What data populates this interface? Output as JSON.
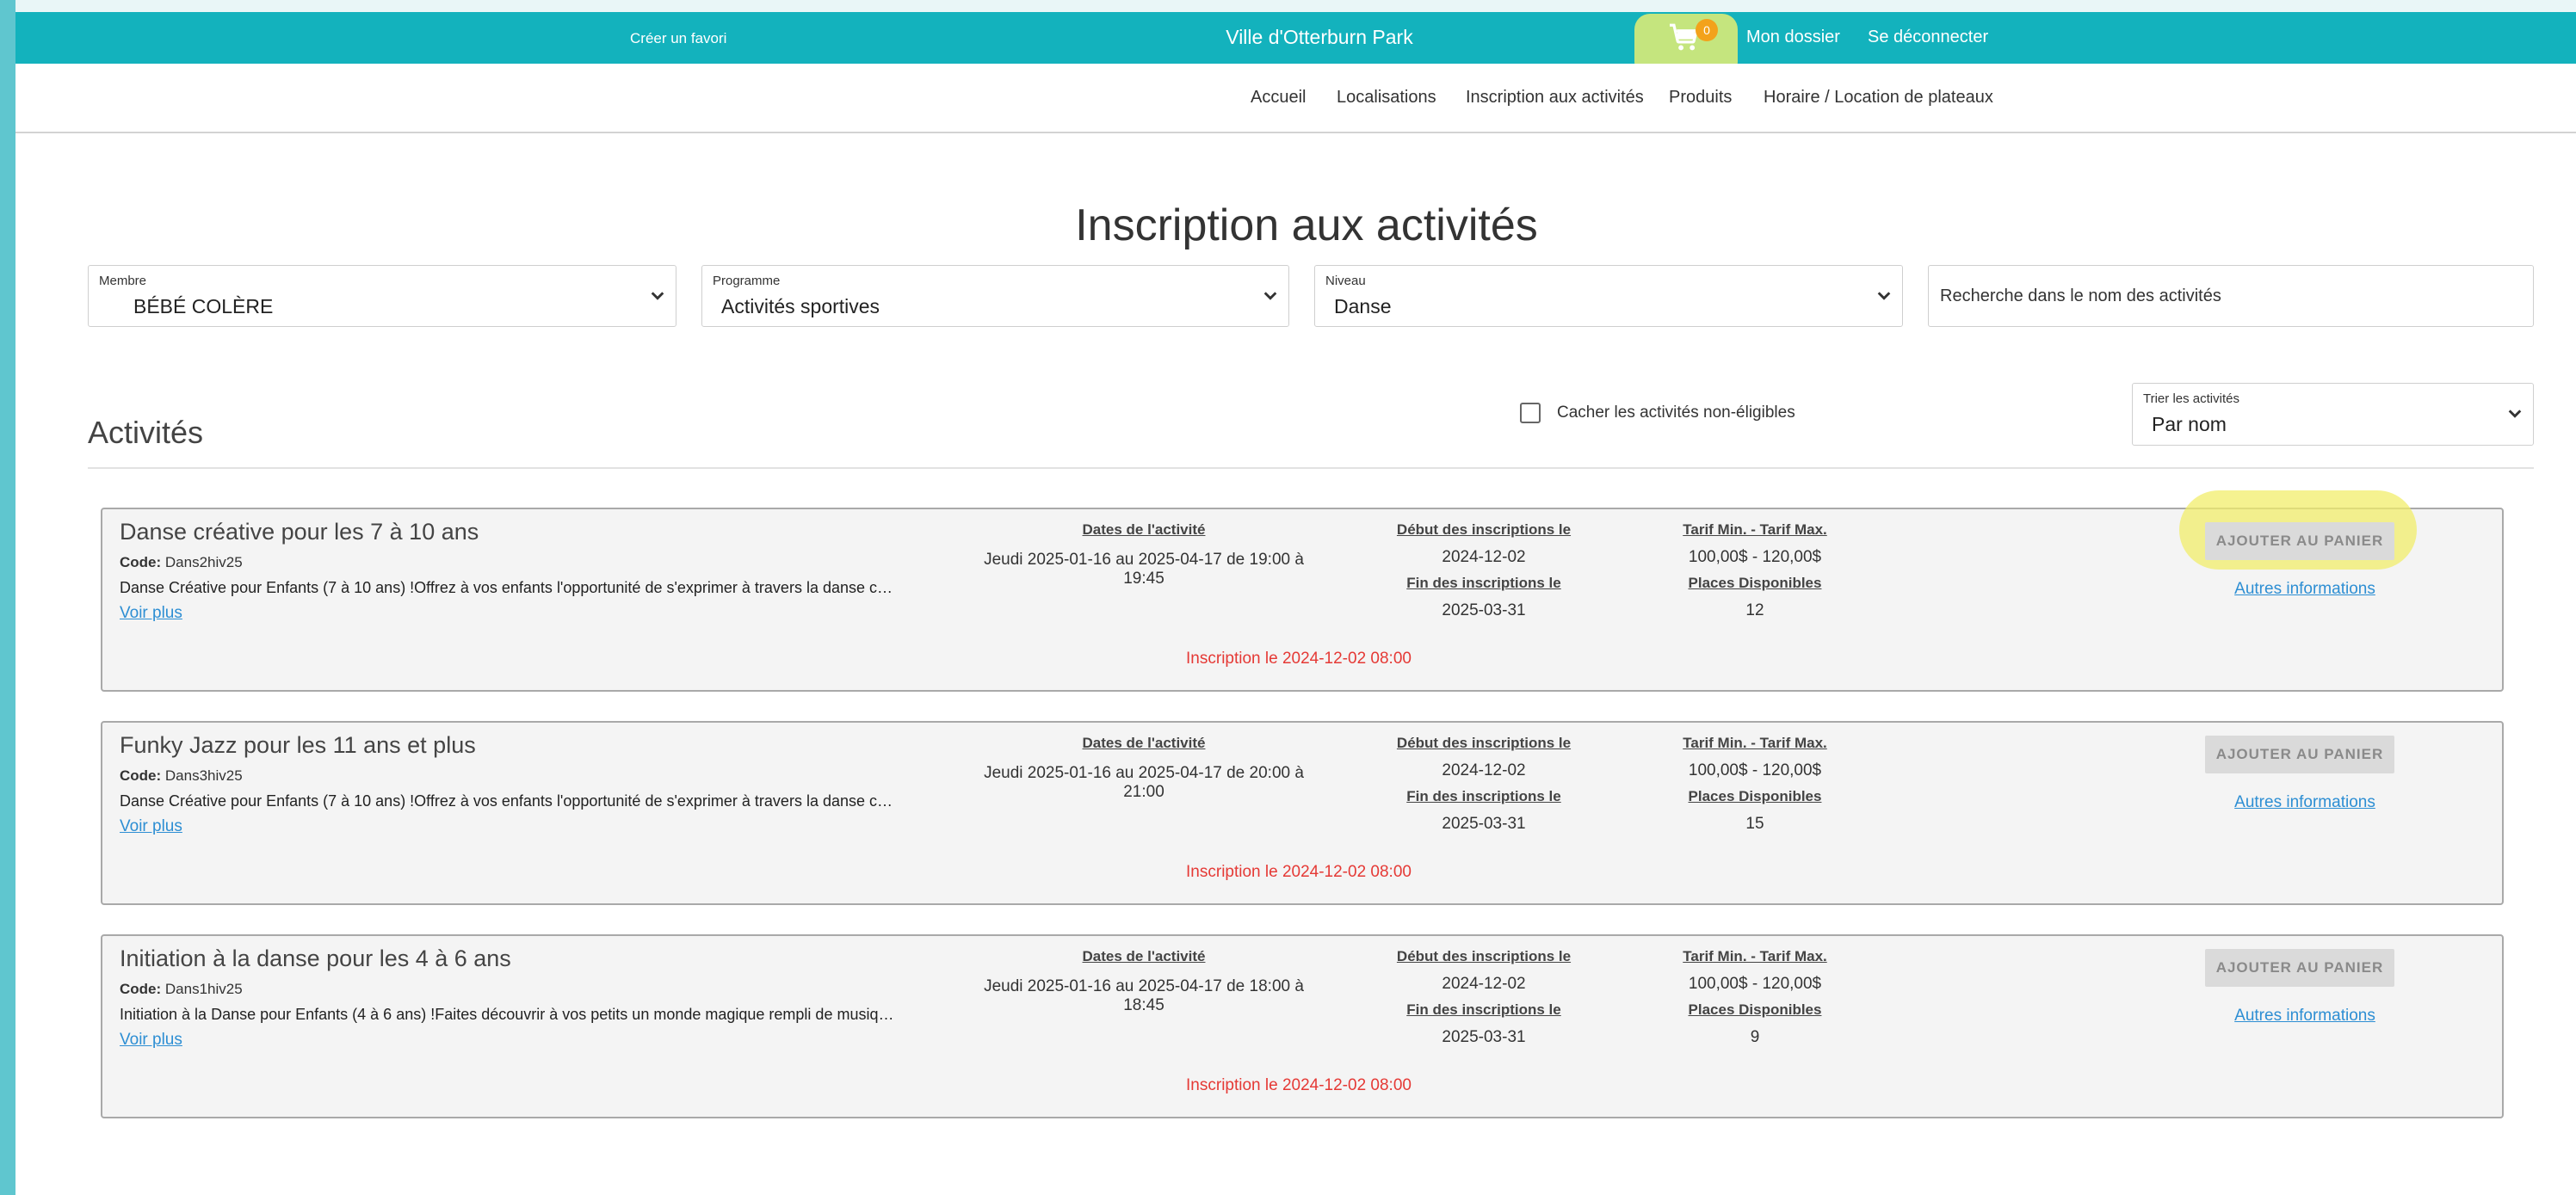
{
  "header": {
    "favorite": "Créer un favori",
    "site_name": "Ville d'Otterburn Park",
    "cart_count": "0",
    "account": "Mon dossier",
    "logout": "Se déconnecter",
    "cart_icon": "shopping-cart-icon"
  },
  "nav": {
    "items": [
      "Accueil",
      "Localisations",
      "Inscription aux activités",
      "Produits",
      "Horaire / Location de plateaux"
    ]
  },
  "page": {
    "title": "Inscription aux activités"
  },
  "filters": {
    "member_label": "Membre",
    "member_value": "BÉBÉ COLÈRE",
    "program_label": "Programme",
    "program_value": "Activités sportives",
    "level_label": "Niveau",
    "level_value": "Danse",
    "search_placeholder": "Recherche dans le nom des activités"
  },
  "activities_section": {
    "title": "Activités",
    "hide_label": "Cacher les activités non-éligibles",
    "sort_label": "Trier les activités",
    "sort_value": "Par nom"
  },
  "labels": {
    "code": "Code:",
    "dates": "Dates de l'activité",
    "reg_start": "Début des inscriptions le",
    "reg_end": "Fin des inscriptions le",
    "tariff": "Tarif Min. - Tarif Max.",
    "places": "Places Disponibles",
    "see_more": "Voir plus",
    "add_to_cart": "AJOUTER AU PANIER",
    "more_info": "Autres informations"
  },
  "activities": [
    {
      "name": "Danse créative pour les 7 à 10 ans",
      "code": "Dans2hiv25",
      "description": "Danse Créative pour Enfants (7 à 10 ans) !Offrez à vos enfants l'opportunité de s'exprimer à travers la danse créative",
      "dates": "Jeudi 2025-01-16 au 2025-04-17 de 19:00 à 19:45",
      "reg_start": "2024-12-02",
      "reg_end": "2025-03-31",
      "tariff": "100,00$ - 120,00$",
      "places": "12",
      "notice": "Inscription le 2024-12-02 08:00"
    },
    {
      "name": "Funky Jazz pour les 11 ans et plus",
      "code": "Dans3hiv25",
      "description": "Danse Créative pour Enfants (7 à 10 ans) !Offrez à vos enfants l'opportunité de s'exprimer à travers la danse créative",
      "dates": "Jeudi 2025-01-16 au 2025-04-17 de 20:00 à 21:00",
      "reg_start": "2024-12-02",
      "reg_end": "2025-03-31",
      "tariff": "100,00$ - 120,00$",
      "places": "15",
      "notice": "Inscription le 2024-12-02 08:00"
    },
    {
      "name": "Initiation à la danse pour les 4 à 6 ans",
      "code": "Dans1hiv25",
      "description": "Initiation à la Danse pour Enfants (4 à 6 ans) !Faites découvrir à vos petits un monde magique rempli de musique",
      "dates": "Jeudi 2025-01-16 au 2025-04-17 de 18:00 à 18:45",
      "reg_start": "2024-12-02",
      "reg_end": "2025-03-31",
      "tariff": "100,00$ - 120,00$",
      "places": "9",
      "notice": "Inscription le 2024-12-02 08:00"
    }
  ]
}
